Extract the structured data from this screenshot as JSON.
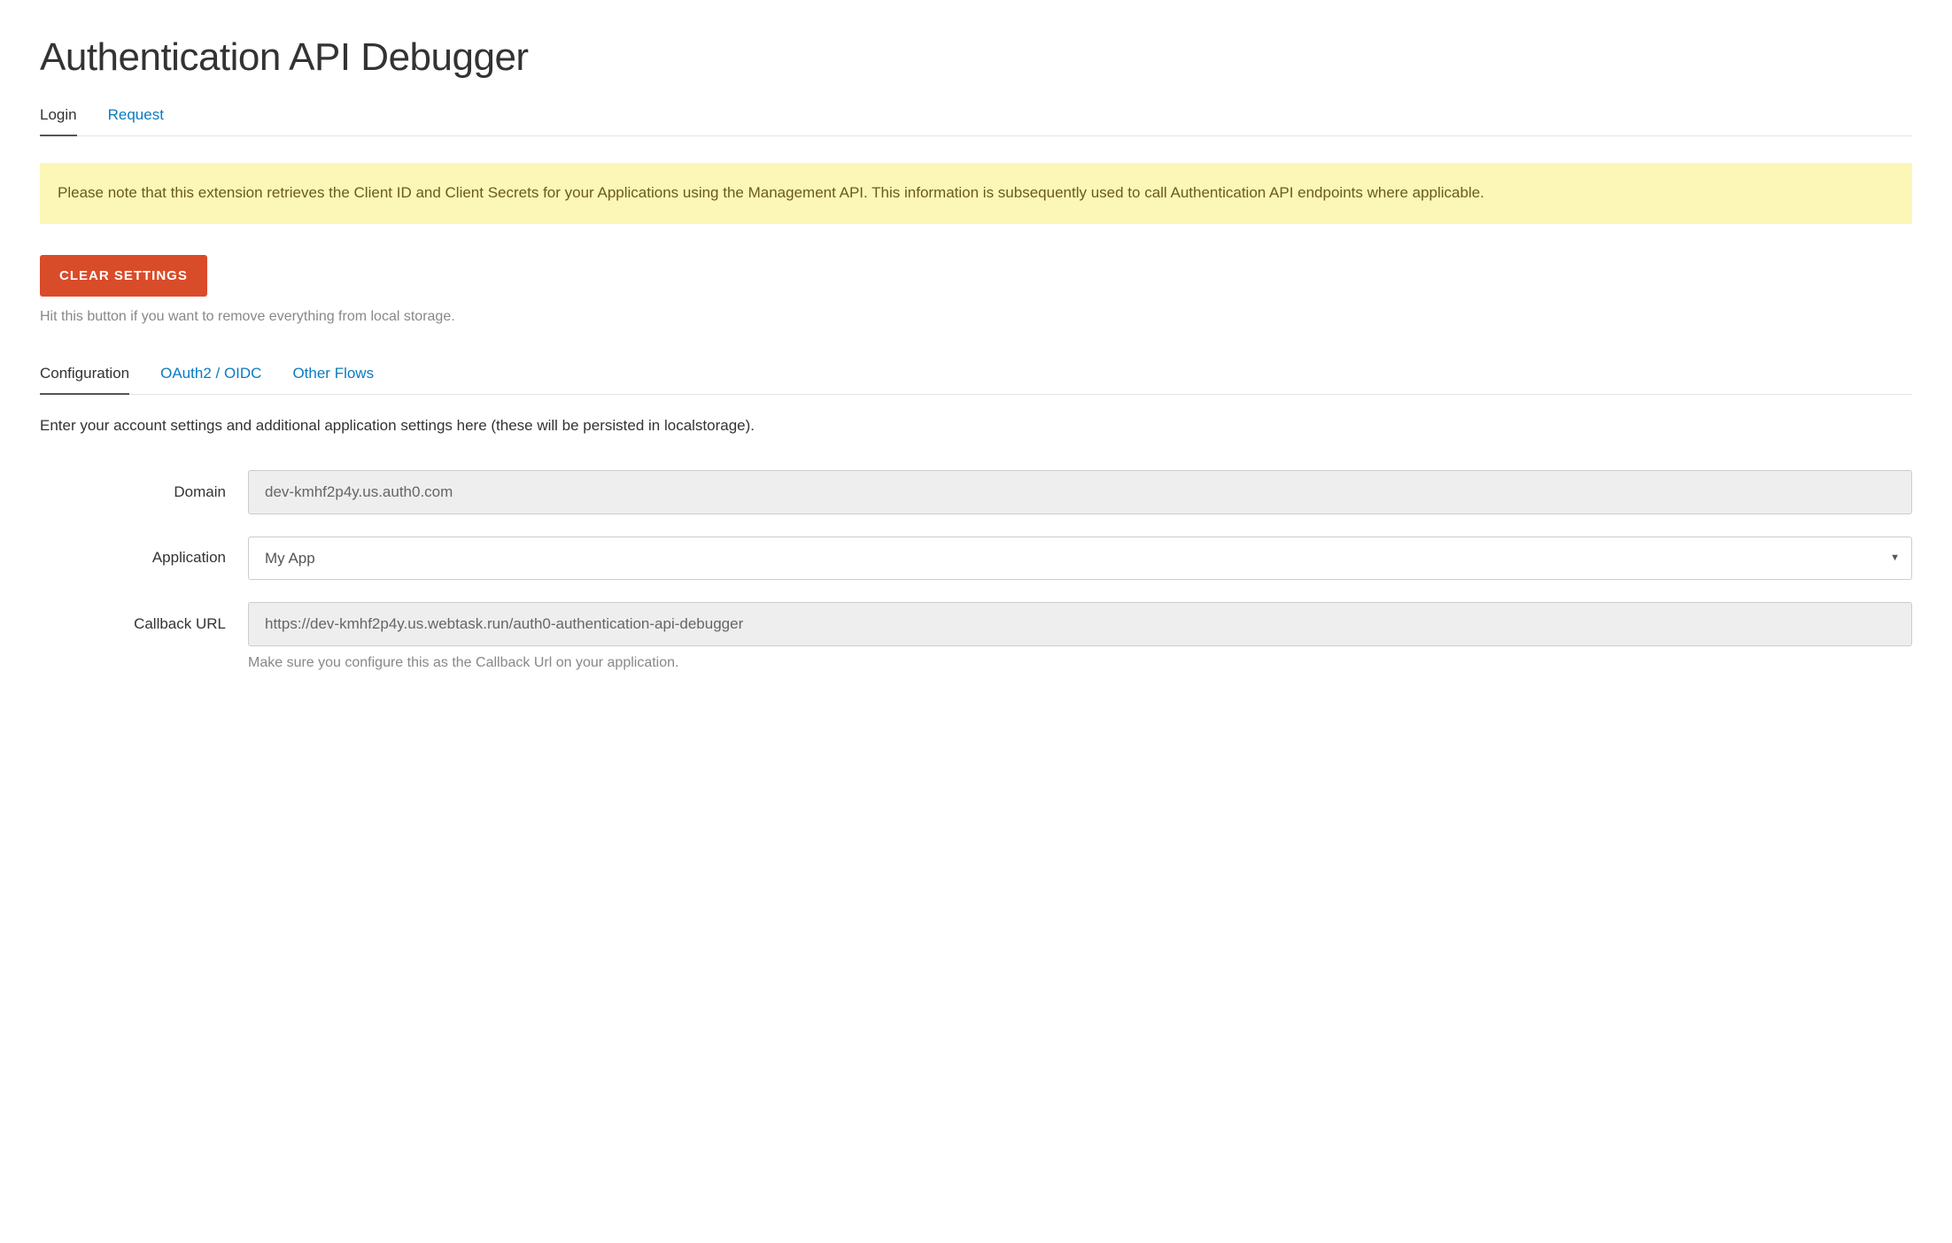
{
  "page": {
    "title": "Authentication API Debugger"
  },
  "topTabs": {
    "login": "Login",
    "request": "Request"
  },
  "alert": {
    "text": "Please note that this extension retrieves the Client ID and Client Secrets for your Applications using the Management API. This information is subsequently used to call Authentication API endpoints where applicable."
  },
  "clearSettings": {
    "label": "CLEAR SETTINGS",
    "help": "Hit this button if you want to remove everything from local storage."
  },
  "subTabs": {
    "configuration": "Configuration",
    "oauth2": "OAuth2 / OIDC",
    "otherFlows": "Other Flows"
  },
  "configSection": {
    "intro": "Enter your account settings and additional application settings here (these will be persisted in localstorage)."
  },
  "form": {
    "domain": {
      "label": "Domain",
      "value": "dev-kmhf2p4y.us.auth0.com"
    },
    "application": {
      "label": "Application",
      "selected": "My App"
    },
    "callback": {
      "label": "Callback URL",
      "value": "https://dev-kmhf2p4y.us.webtask.run/auth0-authentication-api-debugger",
      "hint": "Make sure you configure this as the Callback Url on your application."
    }
  }
}
